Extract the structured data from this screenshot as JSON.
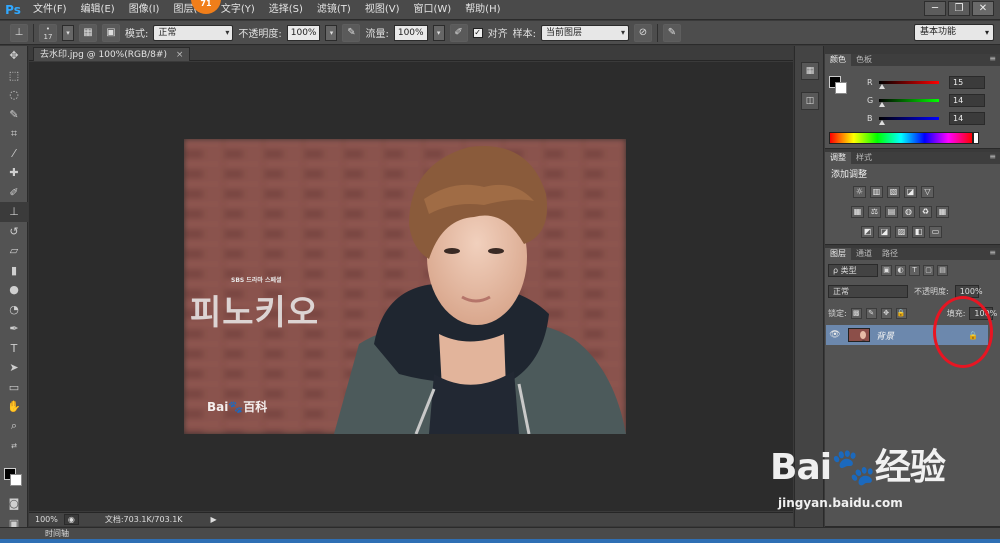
{
  "app": {
    "logo": "Ps"
  },
  "menu": [
    "文件(F)",
    "编辑(E)",
    "图像(I)",
    "图层(L)",
    "文字(Y)",
    "选择(S)",
    "滤镜(T)",
    "视图(V)",
    "窗口(W)",
    "帮助(H)"
  ],
  "notification_badge": "71",
  "window_controls": {
    "minimize": "─",
    "restore": "❐",
    "close": "✕"
  },
  "options": {
    "brush_size": "17",
    "mode_label": "模式:",
    "mode_value": "正常",
    "opacity_label": "不透明度:",
    "opacity_value": "100%",
    "flow_label": "流量:",
    "flow_value": "100%",
    "aligned_label": "对齐",
    "sample_label": "样本:",
    "sample_value": "当前图层",
    "workspace": "基本功能"
  },
  "document": {
    "tab_title": "去水印.jpg @ 100%(RGB/8#)",
    "tab_close": "×",
    "watermark_small": "SBS 드라마 스페셜",
    "watermark_title": "피노키오",
    "watermark_baidu": "Bai🐾百科"
  },
  "status": {
    "zoom": "100%",
    "doc_info": "文档:703.1K/703.1K",
    "play": "▶"
  },
  "timeline_label": "时间轴",
  "color_panel": {
    "tabs": [
      "颜色",
      "色板"
    ],
    "channels": [
      {
        "label": "R",
        "value": "15",
        "gradient": "linear-gradient(to right,#000,#f00)"
      },
      {
        "label": "G",
        "value": "14",
        "gradient": "linear-gradient(to right,#000,#0f0)"
      },
      {
        "label": "B",
        "value": "14",
        "gradient": "linear-gradient(to right,#000,#00f)"
      }
    ]
  },
  "adjust_panel": {
    "tabs": [
      "调整",
      "样式"
    ],
    "heading": "添加调整",
    "row1": [
      "☼",
      "▥",
      "▧",
      "◪",
      "▽"
    ],
    "row2": [
      "▦",
      "⚖",
      "▤",
      "◍",
      "♻",
      "▦"
    ],
    "row3": [
      "◩",
      "◪",
      "▨",
      "◧",
      "▭"
    ]
  },
  "layers_panel": {
    "tabs": [
      "图层",
      "通道",
      "路径"
    ],
    "filter_kind": "ρ 类型",
    "blend_mode": "正常",
    "opacity_label": "不透明度:",
    "opacity_value": "100%",
    "lock_label": "锁定:",
    "fill_label": "填充:",
    "fill_value": "100%",
    "layer_name": "背景",
    "footer_icons": [
      "⊖",
      "fx",
      "◘",
      "◐",
      "▭",
      "▤",
      "🗑"
    ]
  },
  "site_watermark": {
    "logo": "Bai🐾经验",
    "url": "jingyan.baidu.com"
  }
}
